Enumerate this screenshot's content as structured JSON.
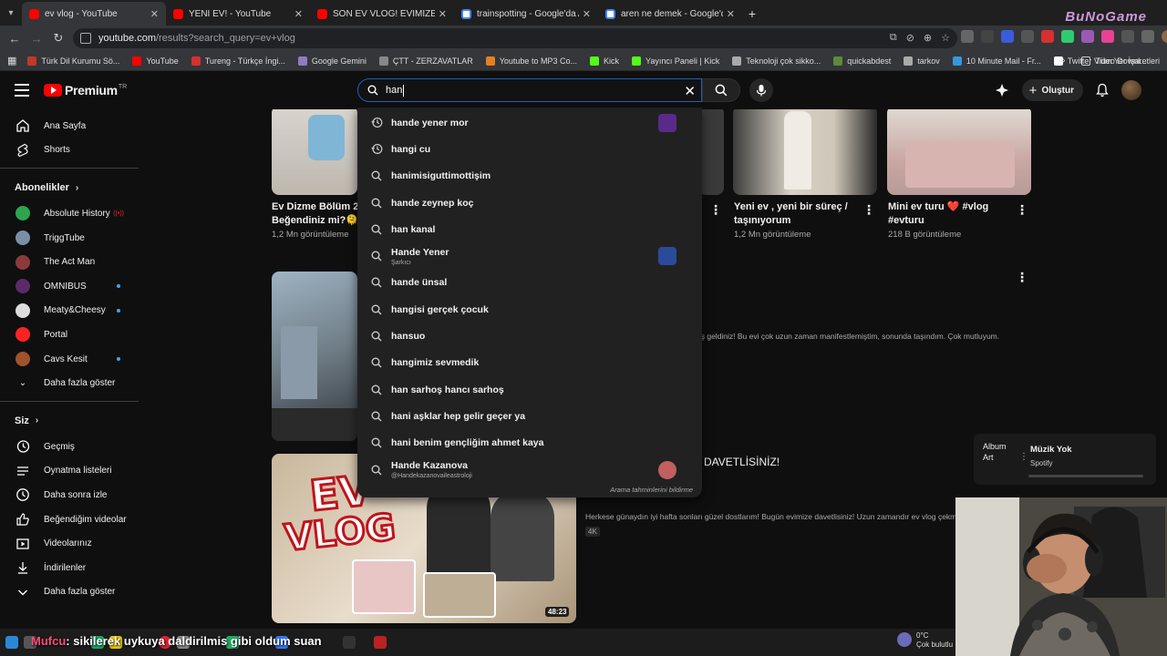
{
  "browser": {
    "tabs": [
      {
        "label": "ev vlog - YouTube",
        "active": true,
        "fav": "yt"
      },
      {
        "label": "YENİ EV! - YouTube",
        "active": false,
        "fav": "yt"
      },
      {
        "label": "SON EV VLOG! EVİMİZE DAVETLİSİNİZ!",
        "active": false,
        "fav": "yt"
      },
      {
        "label": "trainspotting - Google'da Ara",
        "active": false,
        "fav": "g"
      },
      {
        "label": "aren ne demek - Google'da Ara",
        "active": false,
        "fav": "g"
      }
    ],
    "overlay_brand": "BuNoGame",
    "url_host": "youtube.com",
    "url_path": "/results?search_query=ev+vlog",
    "bookmarks": [
      {
        "label": "Türk Dil Kurumu Sö...",
        "color": "#c0392b"
      },
      {
        "label": "YouTube",
        "color": "#ff0000"
      },
      {
        "label": "Tureng - Türkçe İngi...",
        "color": "#d63031"
      },
      {
        "label": "Google Gemini",
        "color": "#8e7cc3"
      },
      {
        "label": "ÇTT - ZERZAVATLAR",
        "color": "#888888"
      },
      {
        "label": "Youtube to MP3 Co...",
        "color": "#e67e22"
      },
      {
        "label": "Kick",
        "color": "#53fc18"
      },
      {
        "label": "Yayıncı Paneli | Kick",
        "color": "#53fc18"
      },
      {
        "label": "Teknoloji çok sikko...",
        "color": "#aaaaaa"
      },
      {
        "label": "quickabdest",
        "color": "#5c8a3a"
      },
      {
        "label": "tarkov",
        "color": "#aaaaaa"
      },
      {
        "label": "10 Minute Mail - Fr...",
        "color": "#3498db"
      },
      {
        "label": "Twitter Video Downl...",
        "color": "#ffffff"
      }
    ],
    "bookmarks_right": "Tüm Yer İşaretleri"
  },
  "youtube": {
    "logo_text": "Premium",
    "logo_region": "TR",
    "search_value": "han",
    "create_label": "Oluştur"
  },
  "sidebar": {
    "main": [
      {
        "label": "Ana Sayfa",
        "icon": "home-icon"
      },
      {
        "label": "Shorts",
        "icon": "shorts-icon"
      }
    ],
    "subs_heading": "Abonelikler",
    "subscriptions": [
      {
        "label": "Absolute History",
        "color": "#2ea44f",
        "badge": "live"
      },
      {
        "label": "TriggTube",
        "color": "#7a8fa6",
        "badge": ""
      },
      {
        "label": "The Act Man",
        "color": "#8b3a3a",
        "badge": ""
      },
      {
        "label": "OMNIBUS",
        "color": "#5a2a6a",
        "badge": "dot"
      },
      {
        "label": "Meaty&Cheesy",
        "color": "#dddddd",
        "badge": "dot"
      },
      {
        "label": "Portal",
        "color": "#ff2222",
        "badge": ""
      },
      {
        "label": "Cavs Kesit",
        "color": "#a0522d",
        "badge": "dot"
      }
    ],
    "show_more_subs": "Daha fazla göster",
    "you_heading": "Siz",
    "you_items": [
      {
        "label": "Geçmiş",
        "icon": "history-icon"
      },
      {
        "label": "Oynatma listeleri",
        "icon": "playlists-icon"
      },
      {
        "label": "Daha sonra izle",
        "icon": "watch-later-icon"
      },
      {
        "label": "Beğendiğim videolar",
        "icon": "like-icon"
      },
      {
        "label": "Videolarınız",
        "icon": "your-videos-icon"
      },
      {
        "label": "İndirilenler",
        "icon": "download-icon"
      },
      {
        "label": "Daha fazla göster",
        "icon": "chevron-down-icon"
      }
    ]
  },
  "videos": {
    "row1": [
      {
        "title_l1": "Ev Dizme Bölüm 2:",
        "title_l2": "Beğendiniz mi?🫠",
        "meta": "1,2 Mn görüntüleme"
      },
      {
        "title_l1": "Yeni ev , yeni bir süreç /",
        "title_l2": "taşınıyorum",
        "meta": "1,2 Mn görüntüleme"
      },
      {
        "title_l1": "Mini ev turu ❤️ #vlog",
        "title_l2": "#evturu",
        "meta": "218 B görüntüleme"
      }
    ],
    "result1_desc": "oş geldiniz! Bu evi çok uzun zaman manifestlemiştim, sonunda taşındım. Çok mutluyum.",
    "result2_title_tail": "DAVETLİSİNİZ!",
    "result2_desc": "Herkese günaydın iyi hafta sonları güzel dostlarım! Bugün evimize davetlisiniz! Uzun zamandır ev vlog çekmemi ve",
    "result2_badge": "4K",
    "result2_duration": "48:23",
    "thumb_text_1": "EV",
    "thumb_text_2": "VLOG"
  },
  "suggestions": {
    "items": [
      {
        "text": "hande yener mor",
        "icon": "history-icon",
        "sub": "",
        "thumb": "#5a2a8a"
      },
      {
        "text": "hangi cu",
        "icon": "history-icon",
        "sub": "",
        "thumb": ""
      },
      {
        "text": "hanimisiguttimottişim",
        "icon": "search-icon",
        "sub": "",
        "thumb": ""
      },
      {
        "text": "hande zeynep koç",
        "icon": "search-icon",
        "sub": "",
        "thumb": ""
      },
      {
        "text": "han kanal",
        "icon": "search-icon",
        "sub": "",
        "thumb": ""
      },
      {
        "text": "Hande Yener",
        "icon": "search-icon",
        "sub": "Şarkıcı",
        "thumb": "#2a4a9a"
      },
      {
        "text": "hande ünsal",
        "icon": "search-icon",
        "sub": "",
        "thumb": ""
      },
      {
        "text": "hangisi gerçek çocuk",
        "icon": "search-icon",
        "sub": "",
        "thumb": ""
      },
      {
        "text": "hansuo",
        "icon": "search-icon",
        "sub": "",
        "thumb": ""
      },
      {
        "text": "hangimiz sevmedik",
        "icon": "search-icon",
        "sub": "",
        "thumb": ""
      },
      {
        "text": "han sarhoş hancı sarhoş",
        "icon": "search-icon",
        "sub": "",
        "thumb": ""
      },
      {
        "text": "hani aşklar hep gelir geçer ya",
        "icon": "search-icon",
        "sub": "",
        "thumb": ""
      },
      {
        "text": "hani benim gençliğim ahmet kaya",
        "icon": "search-icon",
        "sub": "",
        "thumb": ""
      },
      {
        "text": "Hande Kazanova",
        "icon": "search-icon",
        "sub": "@Handekazanovaileastroloji",
        "thumb": "#c06060",
        "circle": true
      }
    ],
    "footer": "Arama tahminlerini bildirme"
  },
  "music_widget": {
    "art_line1": "Album",
    "art_line2": "Art",
    "title": "Müzik Yok",
    "source": "Spotify"
  },
  "ticker": {
    "prefix": "Mufcu",
    "text": ": sikilerek uykuya daldirilmis gibi oldum suan"
  },
  "weather": {
    "temp": "0°C",
    "status": "Çok bulutlu"
  }
}
